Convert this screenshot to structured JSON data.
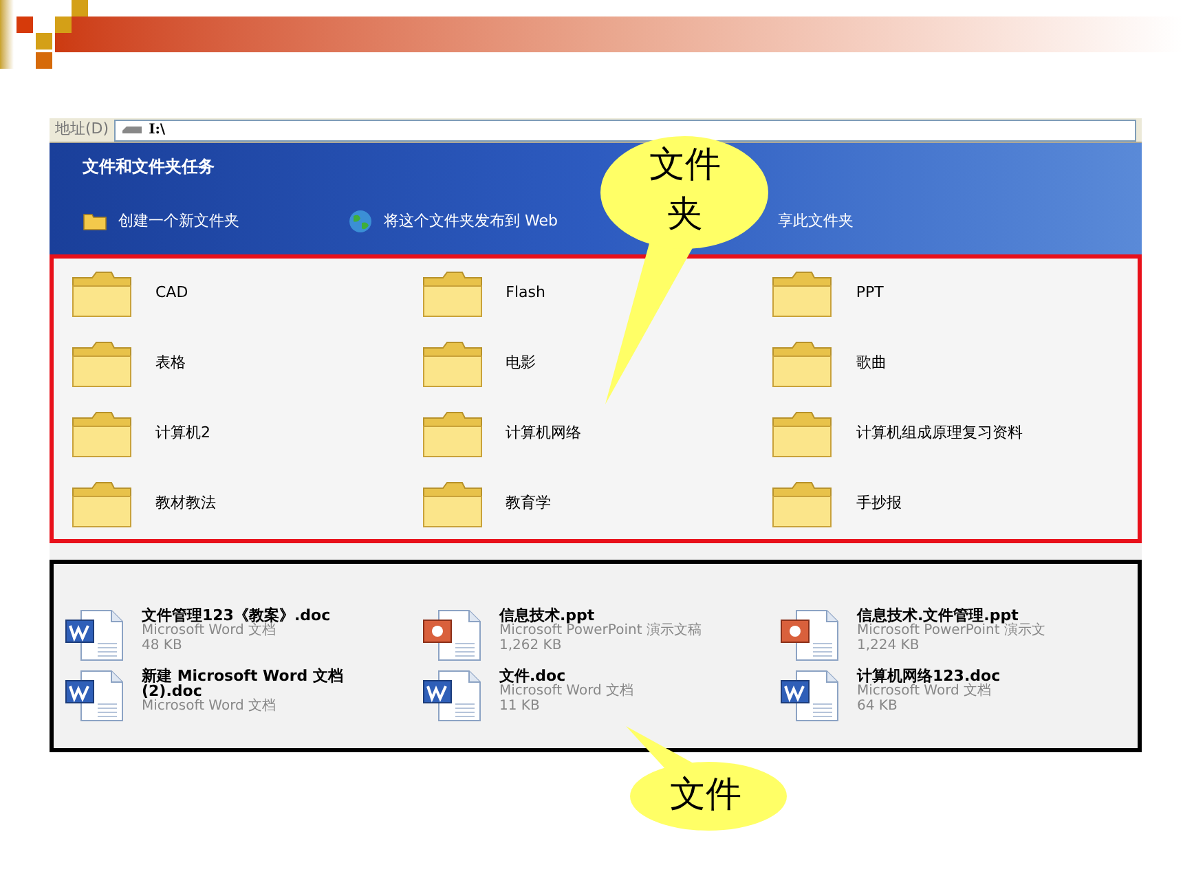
{
  "address_bar": {
    "label": "地址(D)",
    "path": "I:\\"
  },
  "task_pane": {
    "title": "文件和文件夹任务",
    "tasks": [
      {
        "kind": "new-folder",
        "label": "创建一个新文件夹"
      },
      {
        "kind": "publish",
        "label": "将这个文件夹发布到 Web"
      },
      {
        "kind": "share",
        "label": "享此文件夹"
      }
    ]
  },
  "folders": [
    "CAD",
    "Flash",
    "PPT",
    "表格",
    "电影",
    "歌曲",
    "计算机2",
    "计算机网络",
    "计算机组成原理复习资料",
    "教材教法",
    "教育学",
    "手抄报"
  ],
  "files": [
    {
      "kind": "word",
      "name": "文件管理123《教案》.doc",
      "type": "Microsoft Word 文档",
      "size": "48 KB"
    },
    {
      "kind": "powerpoint",
      "name": "信息技术.ppt",
      "type": "Microsoft PowerPoint 演示文稿",
      "size": "1,262 KB"
    },
    {
      "kind": "powerpoint",
      "name": "信息技术.文件管理.ppt",
      "type": "Microsoft PowerPoint 演示文",
      "size": "1,224 KB"
    },
    {
      "kind": "word",
      "name": "新建 Microsoft Word 文档 (2).doc",
      "type": "Microsoft Word 文档"
    },
    {
      "kind": "word",
      "name": "文件.doc",
      "type": "Microsoft Word 文档",
      "size": "11 KB"
    },
    {
      "kind": "word",
      "name": "计算机网络123.doc",
      "type": "Microsoft Word 文档",
      "size": "64 KB"
    }
  ],
  "callouts": [
    {
      "text": "文件夹"
    },
    {
      "text": "文件"
    }
  ]
}
